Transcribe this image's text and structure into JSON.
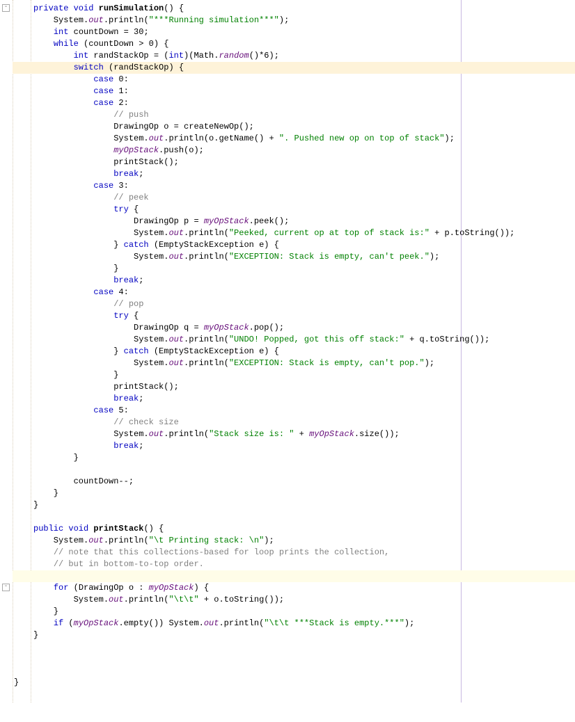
{
  "code": {
    "l1_a": "private void",
    "l1_b": "runSimulation",
    "l1_c": "() {",
    "l2_a": "    System.",
    "l2_out": "out",
    "l2_b": ".println(",
    "l2_s": "\"***Running simulation***\"",
    "l2_c": ");",
    "l3_a": "    ",
    "l3_kw": "int",
    "l3_b": " countDown = 30;",
    "l4_a": "    ",
    "l4_kw": "while",
    "l4_b": " (countDown > 0) {",
    "l5_a": "        ",
    "l5_kw1": "int",
    "l5_b": " randStackOp = (",
    "l5_kw2": "int",
    "l5_c": ")(Math.",
    "l5_rand": "random",
    "l5_d": "()*6);",
    "l6_a": "        ",
    "l6_kw": "switch",
    "l6_b": " (randStackOp) {",
    "l7_a": "            ",
    "l7_kw": "case",
    "l7_b": " 0:",
    "l8_a": "            ",
    "l8_kw": "case",
    "l8_b": " 1:",
    "l9_a": "            ",
    "l9_kw": "case",
    "l9_b": " 2:",
    "l10_a": "                ",
    "l10_c": "// push",
    "l11_a": "                DrawingOp o = createNewOp();",
    "l12_a": "                System.",
    "l12_out": "out",
    "l12_b": ".println(o.getName() + ",
    "l12_s": "\". Pushed new op on top of stack\"",
    "l12_c": ");",
    "l13_a": "                ",
    "l13_f": "myOpStack",
    "l13_b": ".push(o);",
    "l14_a": "                printStack();",
    "l15_a": "                ",
    "l15_kw": "break",
    "l15_b": ";",
    "l16_a": "            ",
    "l16_kw": "case",
    "l16_b": " 3:",
    "l17_a": "                ",
    "l17_c": "// peek",
    "l18_a": "                ",
    "l18_kw": "try",
    "l18_b": " {",
    "l19_a": "                    DrawingOp p = ",
    "l19_f": "myOpStack",
    "l19_b": ".peek();",
    "l20_a": "                    System.",
    "l20_out": "out",
    "l20_b": ".println(",
    "l20_s": "\"Peeked, current op at top of stack is:\"",
    "l20_c": " + p.toString());",
    "l21_a": "                } ",
    "l21_kw": "catch",
    "l21_b": " (EmptyStackException e) {",
    "l22_a": "                    System.",
    "l22_out": "out",
    "l22_b": ".println(",
    "l22_s": "\"EXCEPTION: Stack is empty, can't peek.\"",
    "l22_c": ");",
    "l23_a": "                }",
    "l24_a": "                ",
    "l24_kw": "break",
    "l24_b": ";",
    "l25_a": "            ",
    "l25_kw": "case",
    "l25_b": " 4:",
    "l26_a": "                ",
    "l26_c": "// pop",
    "l27_a": "                ",
    "l27_kw": "try",
    "l27_b": " {",
    "l28_a": "                    DrawingOp q = ",
    "l28_f": "myOpStack",
    "l28_b": ".pop();",
    "l29_a": "                    System.",
    "l29_out": "out",
    "l29_b": ".println(",
    "l29_s": "\"UNDO! Popped, got this off stack:\"",
    "l29_c": " + q.toString());",
    "l30_a": "                } ",
    "l30_kw": "catch",
    "l30_b": " (EmptyStackException e) {",
    "l31_a": "                    System.",
    "l31_out": "out",
    "l31_b": ".println(",
    "l31_s": "\"EXCEPTION: Stack is empty, can't pop.\"",
    "l31_c": ");",
    "l32_a": "                }",
    "l33_a": "                printStack();",
    "l34_a": "                ",
    "l34_kw": "break",
    "l34_b": ";",
    "l35_a": "            ",
    "l35_kw": "case",
    "l35_b": " 5:",
    "l36_a": "                ",
    "l36_c": "// check size",
    "l37_a": "                System.",
    "l37_out": "out",
    "l37_b": ".println(",
    "l37_s": "\"Stack size is: \"",
    "l37_c": " + ",
    "l37_f": "myOpStack",
    "l37_d": ".size());",
    "l38_a": "                ",
    "l38_kw": "break",
    "l38_b": ";",
    "l39_a": "        }",
    "l40_a": "",
    "l41_a": "        countDown--;",
    "l42_a": "    }",
    "l43_a": "}",
    "l44_a": "",
    "l45_a": "public void",
    "l45_b": "printStack",
    "l45_c": "() {",
    "l46_a": "    System.",
    "l46_out": "out",
    "l46_b": ".println(",
    "l46_s": "\"\\t Printing stack: \\n\"",
    "l46_c": ");",
    "l47_a": "    ",
    "l47_c": "// note that this collections-based for loop prints the collection,",
    "l48_a": "    ",
    "l48_c": "// but in bottom-to-top order.",
    "l50_a": "    ",
    "l50_kw": "for",
    "l50_b": " (DrawingOp o : ",
    "l50_f": "myOpStack",
    "l50_c": ") {",
    "l51_a": "        System.",
    "l51_out": "out",
    "l51_b": ".println(",
    "l51_s": "\"\\t\\t\"",
    "l51_c": " + o.toString());",
    "l52_a": "    }",
    "l53_a": "    ",
    "l53_kw": "if",
    "l53_b": " (",
    "l53_f": "myOpStack",
    "l53_c": ".empty()) System.",
    "l53_out": "out",
    "l53_d": ".println(",
    "l53_s": "\"\\t\\t ***Stack is empty.***\"",
    "l53_e": ");",
    "l54_a": "}",
    "l55_a": "",
    "l56_a": "",
    "l57_a": "",
    "l58_a": "}"
  }
}
